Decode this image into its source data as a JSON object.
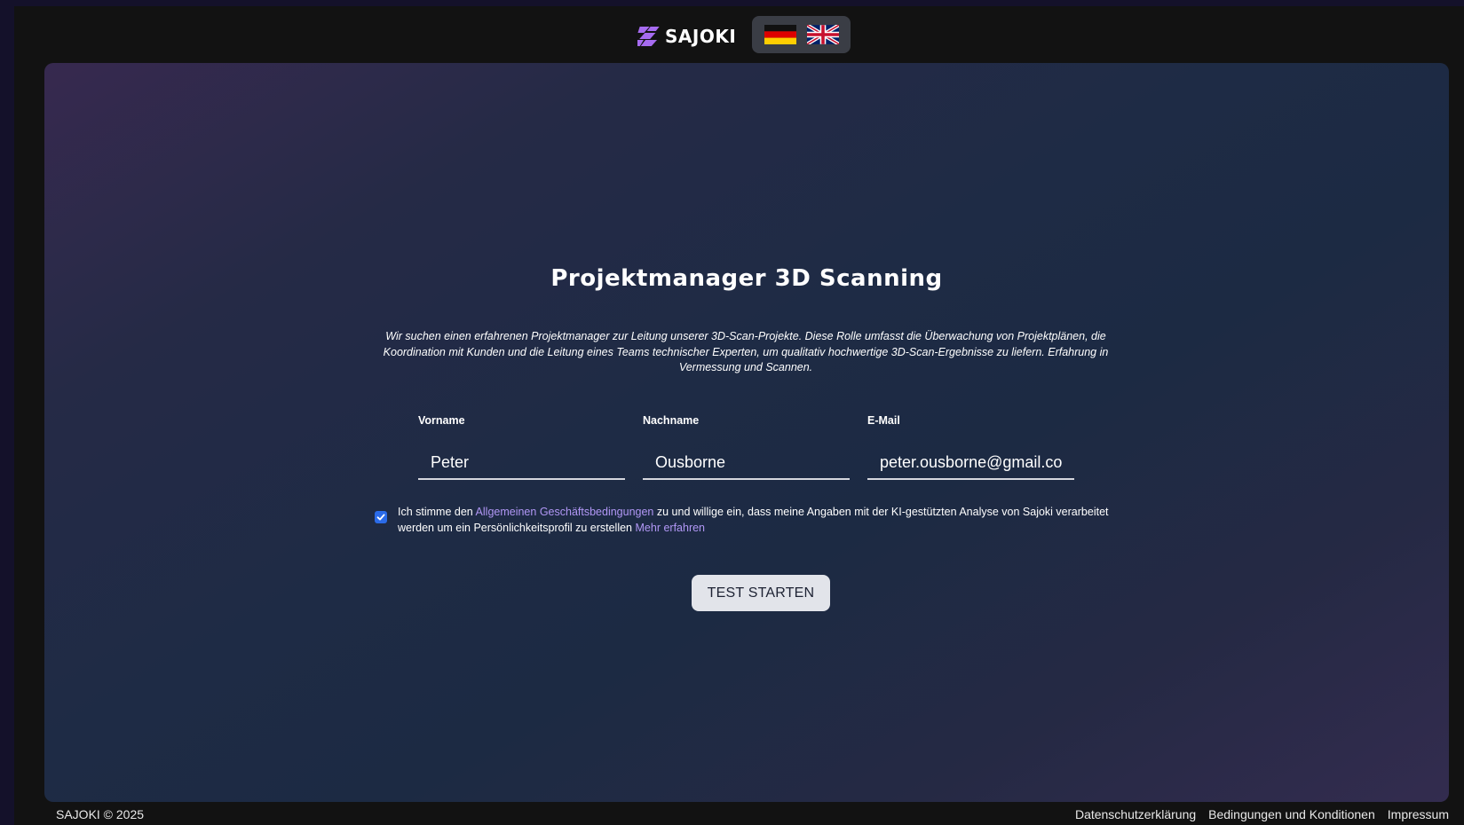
{
  "header": {
    "logo_text": "SAJOKI",
    "languages": [
      {
        "code": "de",
        "icon": "german-flag-icon"
      },
      {
        "code": "en",
        "icon": "uk-flag-icon"
      }
    ]
  },
  "main": {
    "title": "Projektmanager 3D Scanning",
    "description": "Wir suchen einen erfahrenen Projektmanager zur Leitung unserer 3D-Scan-Projekte. Diese Rolle umfasst die Überwachung von Projektplänen, die Koordination mit Kunden und die Leitung eines Teams technischer Experten, um qualitativ hochwertige 3D-Scan-Ergebnisse zu liefern. Erfahrung in Vermessung und Scannen.",
    "form": {
      "first_name": {
        "label": "Vorname",
        "value": "Peter"
      },
      "last_name": {
        "label": "Nachname",
        "value": "Ousborne"
      },
      "email": {
        "label": "E-Mail",
        "value": "peter.ousborne@gmail.com"
      }
    },
    "consent": {
      "checked": true,
      "text_before": "Ich stimme den ",
      "terms_link": "Allgemeinen Geschäftsbedingungen",
      "text_after": " zu und willige ein, dass meine Angaben mit der KI-gestützten Analyse von Sajoki verarbeitet werden um ein Persönlichkeitsprofil zu erstellen ",
      "more_link": "Mehr erfahren"
    },
    "start_button": "TEST STARTEN"
  },
  "footer": {
    "copyright": "SAJOKI © 2025",
    "links": [
      "Datenschutzerklärung",
      "Bedingungen und Konditionen",
      "Impressum"
    ]
  },
  "colors": {
    "accent": "#b197f5",
    "logo": "#a66bf0",
    "checkbox": "#2b6be8",
    "button_bg": "#e2e4ea",
    "page_bg": "#121212"
  }
}
